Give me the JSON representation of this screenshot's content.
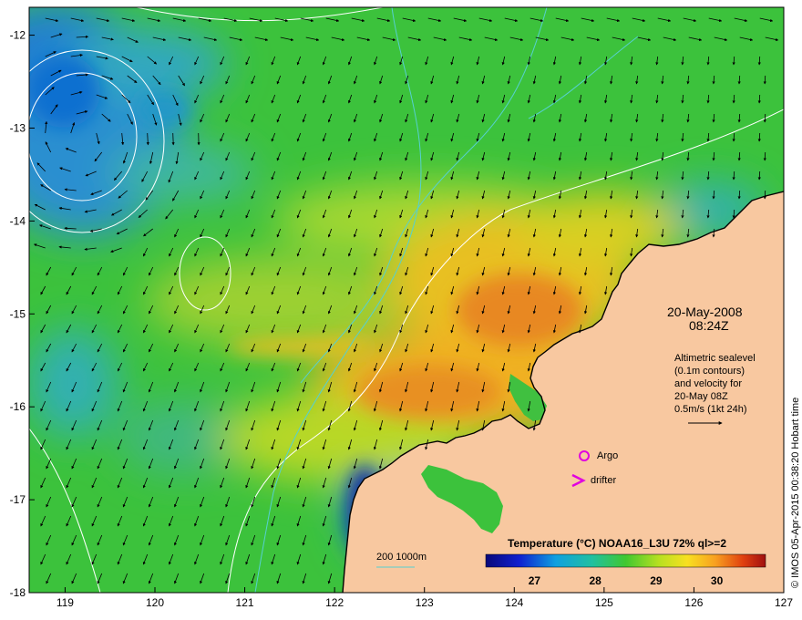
{
  "map": {
    "date": "20-May-2008",
    "time": "08:24Z",
    "info_lines": [
      "Altimetric sealevel",
      "(0.1m contours)",
      "and velocity for",
      "20-May 08Z",
      "0.5m/s (1kt 24h)"
    ],
    "credit": "© IMOS 05-Apr-2015 00:38:20 Hobart time",
    "legend_markers": {
      "argo_label": "Argo",
      "drifter_label": "drifter",
      "argo_color": "#e000e0",
      "drifter_color": "#e000e0"
    },
    "bathymetry_label": "200  1000m",
    "colorbar": {
      "title": "Temperature (°C) NOAA16_L3U 72% ql>=2",
      "ticks": [
        "27",
        "28",
        "29",
        "30"
      ],
      "tick_values": [
        27,
        28,
        29,
        30
      ],
      "range": [
        26.2,
        30.8
      ]
    },
    "x_axis": {
      "ticks": [
        "119",
        "120",
        "121",
        "122",
        "123",
        "124",
        "125",
        "126",
        "127"
      ],
      "values": [
        119,
        120,
        121,
        122,
        123,
        124,
        125,
        126,
        127
      ],
      "range": [
        118.6,
        127
      ]
    },
    "y_axis": {
      "ticks": [
        "-12",
        "-13",
        "-14",
        "-15",
        "-16",
        "-17",
        "-18"
      ],
      "values": [
        -12,
        -13,
        -14,
        -15,
        -16,
        -17,
        -18
      ],
      "range": [
        -11.7,
        -18
      ]
    },
    "colors": {
      "land": "#f8c8a0",
      "sea_cool": "#2a7fc8",
      "sea_mid": "#3cc23c",
      "sea_warm": "#f0b020",
      "sea_hot": "#e07020",
      "contour": "#ffffff",
      "bathy": "#56d0d0"
    }
  }
}
